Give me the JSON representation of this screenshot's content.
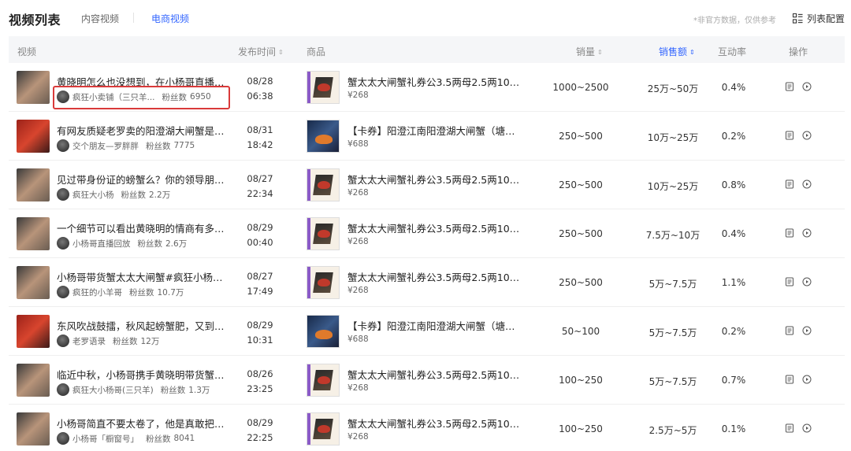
{
  "header": {
    "title": "视频列表",
    "tabs": [
      {
        "label": "内容视频",
        "active": false
      },
      {
        "label": "电商视频",
        "active": true
      }
    ],
    "disclaimer": "*非官方数据，仅供参考",
    "config_label": "列表配置",
    "config_icon": "grid-config-icon",
    "accent_color": "#3366ff"
  },
  "columns": {
    "video": "视频",
    "publish_time": "发布时间",
    "product": "商品",
    "sales": "销量",
    "sales_amount": "销售额",
    "interaction_rate": "互动率",
    "actions": "操作",
    "sort_glyph": "⇕",
    "active_sort_column": "sales_amount"
  },
  "rows": [
    {
      "title": "黄晓明怎么也没想到，在小杨哥直播间...",
      "author": "疯狂小卖铺（三只羊...",
      "fans_label": "粉丝数",
      "fans": "6950",
      "date": "08/28",
      "time": "06:38",
      "product": "蟹太太大闸蟹礼券公3.5两母2.5两10只...",
      "price": "¥268",
      "sales": "1000~2500",
      "amount": "25万~50万",
      "rate": "0.4%",
      "highlighted": true,
      "thumb_style": "mix",
      "thumb_label": "",
      "product_style": "light"
    },
    {
      "title": "有网友质疑老罗卖的阳澄湖大闸蟹是洗...",
      "author": "交个朋友—罗胖胖",
      "fans_label": "粉丝数",
      "fans": "7775",
      "date": "08/31",
      "time": "18:42",
      "product": "【卡券】阳澄江南阳澄湖大闸蟹（塘养...",
      "price": "¥688",
      "sales": "250~500",
      "amount": "10万~25万",
      "rate": "0.2%",
      "highlighted": false,
      "thumb_style": "red",
      "thumb_label": "",
      "product_style": "dark"
    },
    {
      "title": "见过带身份证的螃蟹么？你的领导朋友...",
      "author": "疯狂大小杨",
      "fans_label": "粉丝数",
      "fans": "2.2万",
      "date": "08/27",
      "time": "22:34",
      "product": "蟹太太大闸蟹礼券公3.5两母2.5两10只...",
      "price": "¥268",
      "sales": "250~500",
      "amount": "10万~25万",
      "rate": "0.8%",
      "highlighted": false,
      "thumb_style": "mix",
      "thumb_label": "",
      "product_style": "light"
    },
    {
      "title": "一个细节可以看出黄晓明的情商有多高...",
      "author": "小杨哥直播回放",
      "fans_label": "粉丝数",
      "fans": "2.6万",
      "date": "08/29",
      "time": "00:40",
      "product": "蟹太太大闸蟹礼券公3.5两母2.5两10只...",
      "price": "¥268",
      "sales": "250~500",
      "amount": "7.5万~10万",
      "rate": "0.4%",
      "highlighted": false,
      "thumb_style": "mix",
      "thumb_label": "",
      "product_style": "light"
    },
    {
      "title": "小杨哥带货蟹太太大闸蟹#疯狂小杨哥 ...",
      "author": "疯狂的小羊哥",
      "fans_label": "粉丝数",
      "fans": "10.7万",
      "date": "08/27",
      "time": "17:49",
      "product": "蟹太太大闸蟹礼券公3.5两母2.5两10只...",
      "price": "¥268",
      "sales": "250~500",
      "amount": "5万~7.5万",
      "rate": "1.1%",
      "highlighted": false,
      "thumb_style": "mix",
      "thumb_label": "",
      "product_style": "light"
    },
    {
      "title": "东风吹战鼓擂，秋风起螃蟹肥，又到了...",
      "author": "老罗语录",
      "fans_label": "粉丝数",
      "fans": "12万",
      "date": "08/29",
      "time": "10:31",
      "product": "【卡券】阳澄江南阳澄湖大闸蟹（塘养...",
      "price": "¥688",
      "sales": "50~100",
      "amount": "5万~7.5万",
      "rate": "0.2%",
      "highlighted": false,
      "thumb_style": "red",
      "thumb_label": "",
      "product_style": "dark"
    },
    {
      "title": "临近中秋，小杨哥携手黄晓明带货蟹太...",
      "author": "疯狂大小杨哥(三只羊)",
      "fans_label": "粉丝数",
      "fans": "1.3万",
      "date": "08/26",
      "time": "23:25",
      "product": "蟹太太大闸蟹礼券公3.5两母2.5两10只...",
      "price": "¥268",
      "sales": "100~250",
      "amount": "5万~7.5万",
      "rate": "0.7%",
      "highlighted": false,
      "thumb_style": "mix",
      "thumb_label": "",
      "product_style": "light"
    },
    {
      "title": "小杨哥简直不要太卷了，他是真敢把蟹...",
      "author": "小杨哥「橱窗号」",
      "fans_label": "粉丝数",
      "fans": "8041",
      "date": "08/29",
      "time": "22:25",
      "product": "蟹太太大闸蟹礼券公3.5两母2.5两10只...",
      "price": "¥268",
      "sales": "100~250",
      "amount": "2.5万~5万",
      "rate": "0.1%",
      "highlighted": false,
      "thumb_style": "mix",
      "thumb_label": "",
      "product_style": "light"
    }
  ],
  "row_actions": {
    "detail_icon": "document-icon",
    "play_icon": "play-circle-icon"
  },
  "colors": {
    "highlight_border": "#d93a3a",
    "header_bg": "#f5f6f8"
  }
}
